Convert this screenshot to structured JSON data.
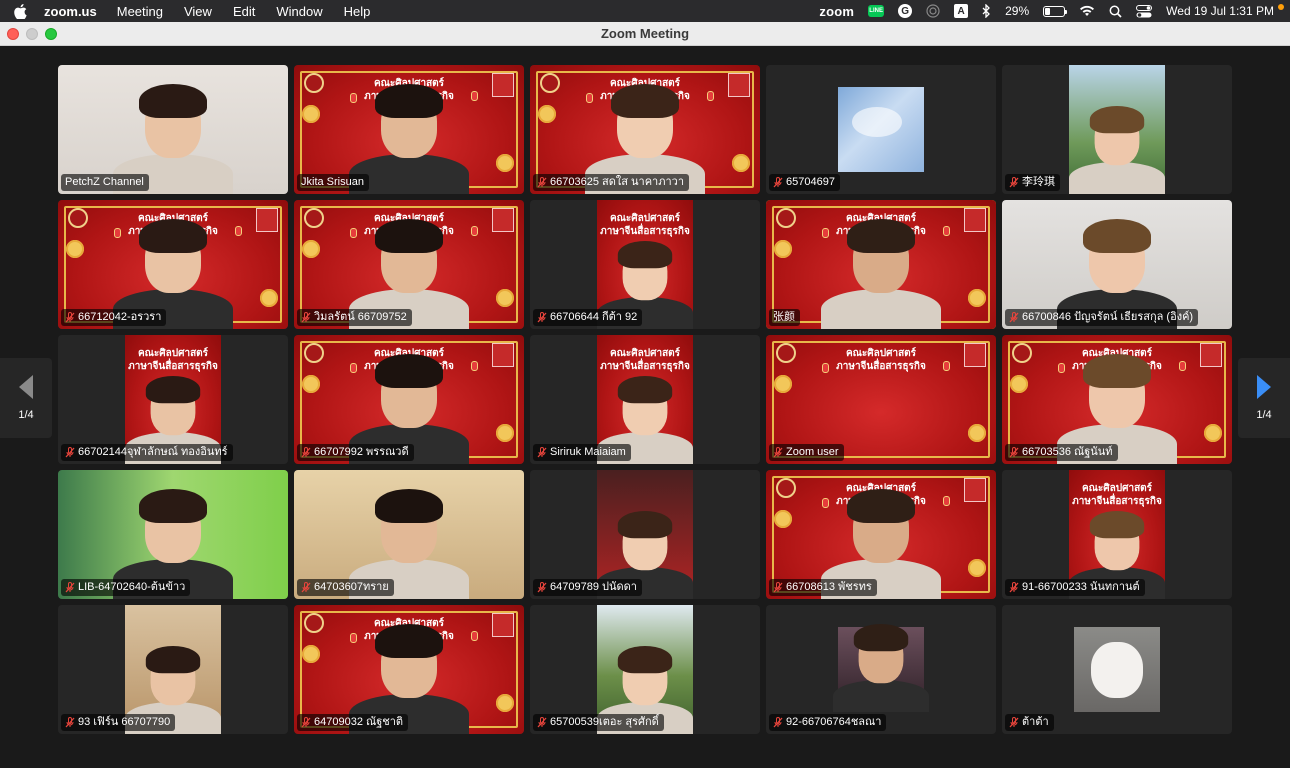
{
  "menubar": {
    "app_name": "zoom.us",
    "menus": [
      "Meeting",
      "View",
      "Edit",
      "Window",
      "Help"
    ],
    "status_zoom": "zoom",
    "status_line": "LINE",
    "status_g": "G",
    "status_a": "A",
    "battery": "29%",
    "battery_level": 0.29,
    "datetime": "Wed 19 Jul  1:31 PM"
  },
  "window": {
    "title": "Zoom Meeting"
  },
  "pager": {
    "left_label": "1/4",
    "right_label": "1/4"
  },
  "participants": [
    {
      "name": "PetchZ Channel",
      "muted": false,
      "bg": "room1",
      "banner": false
    },
    {
      "name": "Jkita Srisuan",
      "muted": false,
      "bg": "red",
      "banner": true
    },
    {
      "name": "66703625 สดใส นาคาภาวา",
      "muted": true,
      "bg": "red",
      "banner": true
    },
    {
      "name": "65704697",
      "muted": true,
      "bg": "sky",
      "banner": false,
      "narrow": true
    },
    {
      "name": "李玲琪",
      "muted": true,
      "bg": "outdoor",
      "banner": false,
      "narrow": true
    },
    {
      "name": "66712042-อรวรา",
      "muted": true,
      "bg": "red",
      "banner": true
    },
    {
      "name": "วิมลรัตน์ 66709752",
      "muted": true,
      "bg": "red",
      "banner": true
    },
    {
      "name": "66706644 กีต้า 92",
      "muted": true,
      "bg": "red",
      "banner": true,
      "narrow": true
    },
    {
      "name": "张颜",
      "muted": false,
      "bg": "red",
      "banner": true,
      "active": true
    },
    {
      "name": "66700846 ปัญจรัตน์ เธียรสกุล (อิงค์)",
      "muted": true,
      "bg": "room2",
      "banner": false
    },
    {
      "name": "66702144จุฬาลักษณ์ ทองอินทร์",
      "muted": true,
      "bg": "red",
      "banner": true,
      "narrow": true
    },
    {
      "name": "66707992 พรรณวดี",
      "muted": true,
      "bg": "red",
      "banner": true
    },
    {
      "name": "Siriruk Maiaiam",
      "muted": true,
      "bg": "red",
      "banner": true,
      "narrow": true
    },
    {
      "name": "Zoom user",
      "muted": true,
      "bg": "red",
      "banner": true,
      "empty": true
    },
    {
      "name": "66703536 ณัฐนันท์",
      "muted": true,
      "bg": "red",
      "banner": true
    },
    {
      "name": "LIB-64702640-ต้นข้าว",
      "muted": true,
      "bg": "green",
      "banner": false
    },
    {
      "name": "64703607ทราย",
      "muted": true,
      "bg": "beige",
      "banner": false
    },
    {
      "name": "64709789 ปนัดดา",
      "muted": true,
      "bg": "darkroom",
      "banner": false,
      "narrow": true
    },
    {
      "name": "66708613 พัชรทร",
      "muted": true,
      "bg": "red",
      "banner": true
    },
    {
      "name": "91-66700233 นันทกานต์",
      "muted": true,
      "bg": "red",
      "banner": true,
      "narrow": true
    },
    {
      "name": "93 เฟิร์น 66707790",
      "muted": true,
      "bg": "wood",
      "banner": false,
      "narrow": true
    },
    {
      "name": "64709032 ณัฐชาติ",
      "muted": true,
      "bg": "red",
      "banner": true
    },
    {
      "name": "65700539เตอะ สุรศักดิ์",
      "muted": true,
      "bg": "trees",
      "banner": false,
      "narrow": true
    },
    {
      "name": "92-66706764ชลณา",
      "muted": true,
      "bg": "filter",
      "banner": false,
      "small": true
    },
    {
      "name": "ต้าต้า",
      "muted": true,
      "bg": "dog",
      "banner": false,
      "small": true
    }
  ],
  "banner_caption": [
    "คณะศิลปศาสตร์",
    "ภาษาจีนสื่อสารธุรกิจ"
  ],
  "banner_stamp": [
    "汉商",
    "语务"
  ],
  "colors": {
    "active_speaker": "#7ed957",
    "muted_icon": "#e8453c",
    "pager_arrow": "#3a8ef6"
  }
}
